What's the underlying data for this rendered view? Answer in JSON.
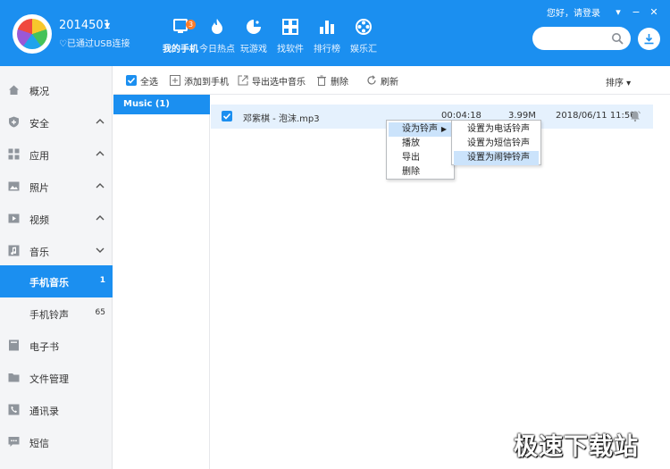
{
  "header": {
    "device_name": "2014501",
    "usb_status": "♡已通过USB连接",
    "greeting": "您好，请登录",
    "window_controls": [
      "▾",
      "−",
      "✕"
    ],
    "nav": [
      {
        "label": "我的手机",
        "icon": "phone-icon",
        "badge": "3",
        "active": true
      },
      {
        "label": "今日热点",
        "icon": "flame-icon",
        "active": false
      },
      {
        "label": "玩游戏",
        "icon": "game-icon",
        "active": false
      },
      {
        "label": "找软件",
        "icon": "apps-icon",
        "active": false
      },
      {
        "label": "排行榜",
        "icon": "ranking-icon",
        "active": false
      },
      {
        "label": "娱乐汇",
        "icon": "film-reel-icon",
        "active": false
      }
    ],
    "search": {
      "placeholder": ""
    }
  },
  "sidebar": {
    "items": [
      {
        "label": "概况",
        "icon": "home-icon",
        "caret": ""
      },
      {
        "label": "安全",
        "icon": "shield-icon",
        "caret": "up"
      },
      {
        "label": "应用",
        "icon": "apps-grid-icon",
        "caret": "up"
      },
      {
        "label": "照片",
        "icon": "photo-icon",
        "caret": "up"
      },
      {
        "label": "视频",
        "icon": "video-icon",
        "caret": "up"
      },
      {
        "label": "音乐",
        "icon": "music-icon",
        "caret": "down"
      },
      {
        "label": "手机音乐",
        "count": "1",
        "active": true,
        "sub": true
      },
      {
        "label": "手机铃声",
        "count": "65",
        "sub": true
      },
      {
        "label": "电子书",
        "icon": "book-icon"
      },
      {
        "label": "文件管理",
        "icon": "folder-icon"
      },
      {
        "label": "通讯录",
        "icon": "contacts-icon"
      },
      {
        "label": "短信",
        "icon": "sms-icon"
      }
    ]
  },
  "toolbar": {
    "select_all": "全选",
    "add_to_phone": "添加到手机",
    "export_selected": "导出选中音乐",
    "delete": "删除",
    "refresh": "刷新",
    "sort": "排序 ▾"
  },
  "categories": [
    {
      "label": "Music (1)"
    }
  ],
  "files": [
    {
      "name": "邓紫棋 - 泡沫.mp3",
      "duration": "00:04:18",
      "size": "3.99M",
      "date": "2018/06/11 11:56"
    }
  ],
  "context_menu": {
    "items": [
      "设为铃声",
      "播放",
      "导出",
      "删除"
    ],
    "submenu": [
      "设置为电话铃声",
      "设置为短信铃声",
      "设置为闹钟铃声"
    ]
  },
  "watermark": "极速下载站",
  "colors": {
    "primary": "#1b8ff0",
    "badge": "#ff7c29",
    "selected_row": "#e5f1fd",
    "menu_highlight": "#cbe3fb"
  }
}
